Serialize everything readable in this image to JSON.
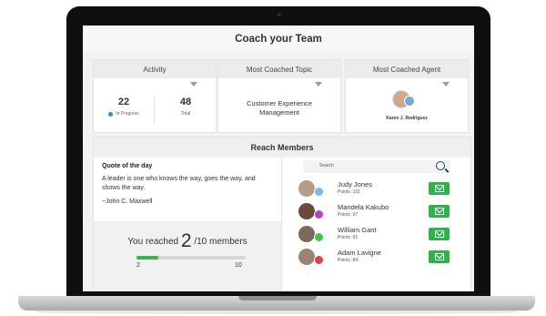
{
  "header": {
    "title": "Coach your Team"
  },
  "activity": {
    "title": "Activity",
    "in_progress_value": "22",
    "in_progress_label": "In Progress",
    "total_value": "48",
    "total_label": "Total"
  },
  "topic": {
    "title": "Most Coached Topic",
    "value_line1": "Customer Experience",
    "value_line2": "Management"
  },
  "agent": {
    "title": "Most Coached Agent",
    "name": "Karen J. Rodriguez"
  },
  "reach": {
    "title": "Reach Members",
    "quote_title": "Quote of  the day",
    "quote_text": "A leader is one who knows the way,  goes the way, and shows the way.",
    "quote_author": "~John C. Maxwell",
    "reached_prefix": "You reached",
    "reached_count": "2",
    "reached_suffix": "/10 members",
    "progress_fraction": 0.2,
    "progress_start": "2",
    "progress_end": "10"
  },
  "search": {
    "placeholder": "Search"
  },
  "members": [
    {
      "name": "Judy Jones",
      "points": "Points :101",
      "badge": "#7ab8e6"
    },
    {
      "name": "Mandela Kakubo",
      "points": "Points :97",
      "badge": "#c13bd0"
    },
    {
      "name": "William Gant",
      "points": "Points :91",
      "badge": "#3fc54b"
    },
    {
      "name": "Adam Lavigne",
      "points": "Points :84",
      "badge": "#e0444b"
    }
  ],
  "colors": {
    "accent_green": "#2eb34a",
    "accent_blue": "#1c3f7f"
  }
}
